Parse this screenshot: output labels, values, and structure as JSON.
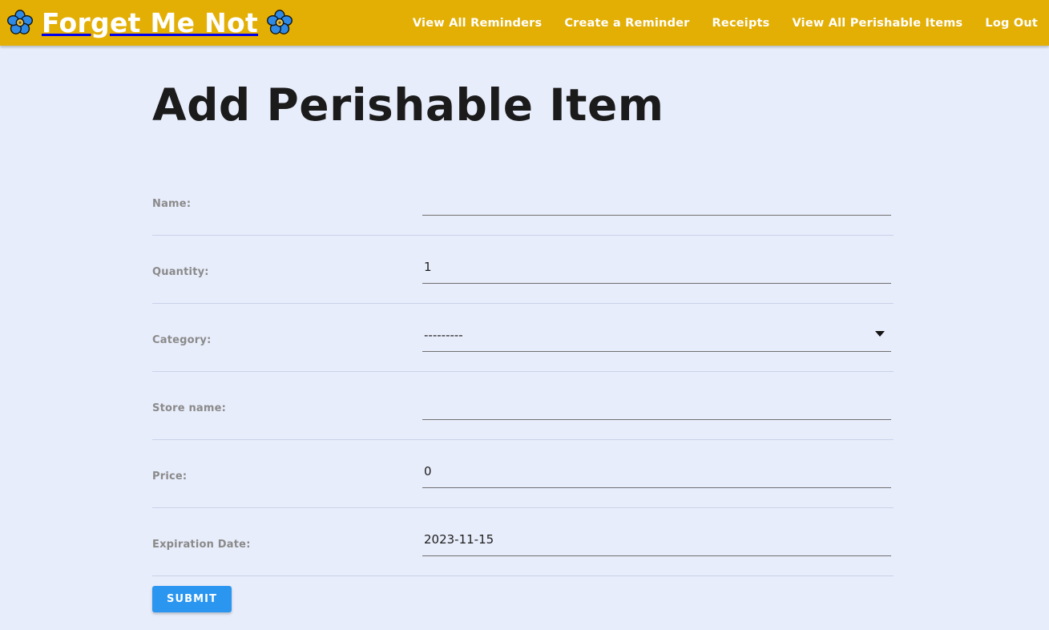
{
  "header": {
    "brand": "Forget Me Not",
    "brand_color": "#e3af05",
    "flower_petal_color": "#2e8ae6",
    "flower_center_color": "#e8c84a",
    "nav": [
      {
        "label": "View All Reminders"
      },
      {
        "label": "Create a Reminder"
      },
      {
        "label": "Receipts"
      },
      {
        "label": "View All Perishable Items"
      },
      {
        "label": "Log Out"
      }
    ]
  },
  "main": {
    "title": "Add Perishable Item",
    "fields": [
      {
        "key": "name",
        "label": "Name:",
        "value": "",
        "placeholder": ""
      },
      {
        "key": "quantity",
        "label": "Quantity:",
        "value": "1",
        "placeholder": ""
      },
      {
        "key": "category",
        "label": "Category:",
        "value": "---------",
        "placeholder": ""
      },
      {
        "key": "store_name",
        "label": "Store name:",
        "value": "",
        "placeholder": ""
      },
      {
        "key": "price",
        "label": "Price:",
        "value": "0",
        "placeholder": ""
      },
      {
        "key": "expiration",
        "label": "Expiration Date:",
        "value": "2023-11-15",
        "placeholder": ""
      }
    ],
    "submit_label": "SUBMIT",
    "submit_color": "#2a96f0"
  }
}
